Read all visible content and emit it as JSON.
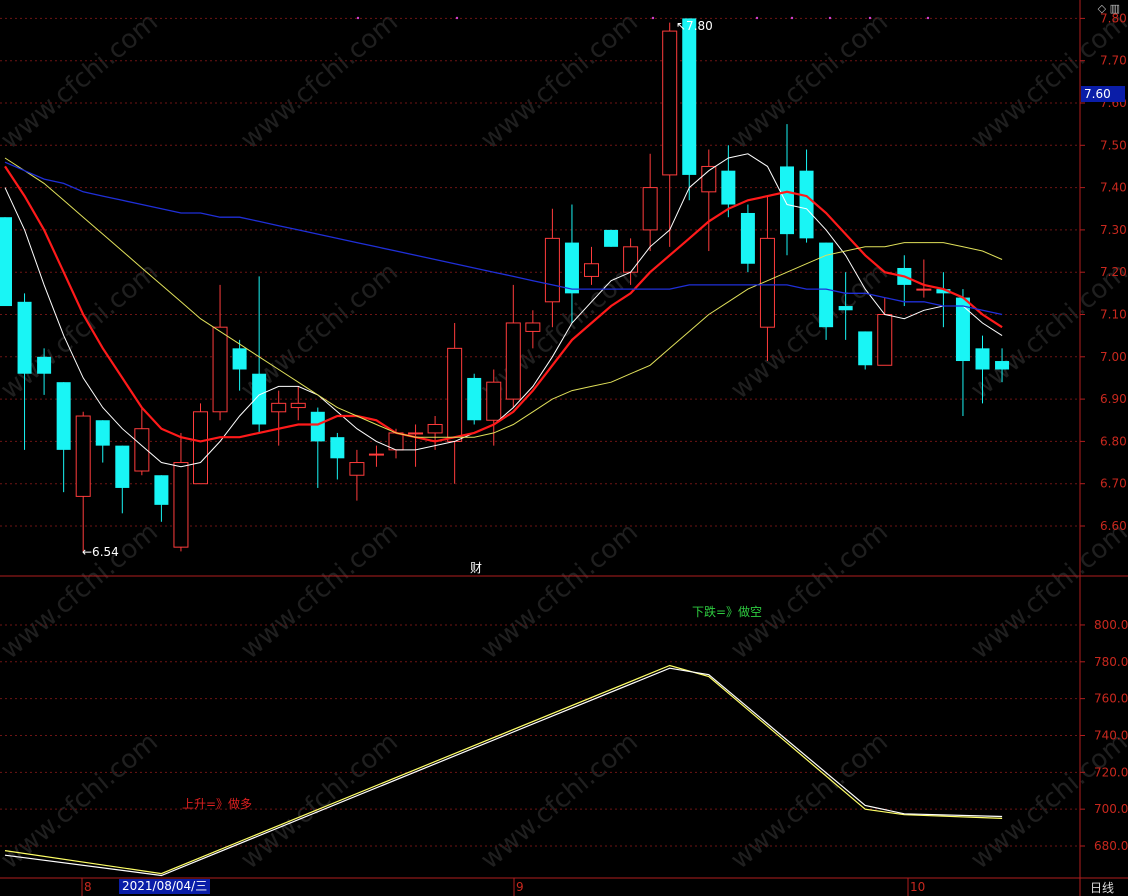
{
  "chart_data": {
    "type": "candlestick",
    "price_axis": {
      "ticks": [
        "7.80",
        "7.70",
        "7.60",
        "7.50",
        "7.40",
        "7.30",
        "7.20",
        "7.10",
        "7.00",
        "6.90",
        "6.80",
        "6.70",
        "6.60"
      ],
      "range": [
        6.48,
        7.82
      ]
    },
    "current_price": "7.60",
    "high_label": "7.80",
    "low_label": "6.54",
    "event_marker": "财",
    "candles": [
      {
        "o": 7.33,
        "c": 7.12,
        "h": 7.33,
        "l": 7.12
      },
      {
        "o": 7.13,
        "c": 6.96,
        "h": 7.15,
        "l": 6.78
      },
      {
        "o": 7.0,
        "c": 6.96,
        "h": 7.02,
        "l": 6.91
      },
      {
        "o": 6.94,
        "c": 6.78,
        "h": 6.94,
        "l": 6.68
      },
      {
        "o": 6.67,
        "c": 6.86,
        "h": 6.87,
        "l": 6.54
      },
      {
        "o": 6.85,
        "c": 6.79,
        "h": 6.85,
        "l": 6.75
      },
      {
        "o": 6.79,
        "c": 6.69,
        "h": 6.79,
        "l": 6.63
      },
      {
        "o": 6.73,
        "c": 6.83,
        "h": 6.88,
        "l": 6.72
      },
      {
        "o": 6.72,
        "c": 6.65,
        "h": 6.72,
        "l": 6.61
      },
      {
        "o": 6.55,
        "c": 6.75,
        "h": 6.82,
        "l": 6.54
      },
      {
        "o": 6.7,
        "c": 6.87,
        "h": 6.89,
        "l": 6.7
      },
      {
        "o": 6.87,
        "c": 7.07,
        "h": 7.17,
        "l": 6.85
      },
      {
        "o": 7.02,
        "c": 6.97,
        "h": 7.04,
        "l": 6.92
      },
      {
        "o": 6.96,
        "c": 6.84,
        "h": 7.19,
        "l": 6.82
      },
      {
        "o": 6.87,
        "c": 6.89,
        "h": 6.92,
        "l": 6.79
      },
      {
        "o": 6.88,
        "c": 6.89,
        "h": 6.93,
        "l": 6.85
      },
      {
        "o": 6.87,
        "c": 6.8,
        "h": 6.88,
        "l": 6.69
      },
      {
        "o": 6.81,
        "c": 6.76,
        "h": 6.82,
        "l": 6.71
      },
      {
        "o": 6.72,
        "c": 6.75,
        "h": 6.78,
        "l": 6.66
      },
      {
        "o": 6.77,
        "c": 6.77,
        "h": 6.79,
        "l": 6.74
      },
      {
        "o": 6.78,
        "c": 6.82,
        "h": 6.83,
        "l": 6.76
      },
      {
        "o": 6.82,
        "c": 6.82,
        "h": 6.84,
        "l": 6.74
      },
      {
        "o": 6.82,
        "c": 6.84,
        "h": 6.86,
        "l": 6.78
      },
      {
        "o": 6.8,
        "c": 7.02,
        "h": 7.08,
        "l": 6.7
      },
      {
        "o": 6.95,
        "c": 6.85,
        "h": 6.96,
        "l": 6.84
      },
      {
        "o": 6.85,
        "c": 6.94,
        "h": 6.97,
        "l": 6.79
      },
      {
        "o": 6.9,
        "c": 7.08,
        "h": 7.17,
        "l": 6.88
      },
      {
        "o": 7.06,
        "c": 7.08,
        "h": 7.11,
        "l": 7.02
      },
      {
        "o": 7.13,
        "c": 7.28,
        "h": 7.35,
        "l": 7.07
      },
      {
        "o": 7.27,
        "c": 7.15,
        "h": 7.36,
        "l": 7.08
      },
      {
        "o": 7.19,
        "c": 7.22,
        "h": 7.26,
        "l": 7.17
      },
      {
        "o": 7.3,
        "c": 7.26,
        "h": 7.3,
        "l": 7.26
      },
      {
        "o": 7.2,
        "c": 7.26,
        "h": 7.28,
        "l": 7.17
      },
      {
        "o": 7.3,
        "c": 7.4,
        "h": 7.48,
        "l": 7.25
      },
      {
        "o": 7.43,
        "c": 7.77,
        "h": 7.79,
        "l": 7.26
      },
      {
        "o": 7.8,
        "c": 7.43,
        "h": 7.8,
        "l": 7.37
      },
      {
        "o": 7.39,
        "c": 7.45,
        "h": 7.49,
        "l": 7.25
      },
      {
        "o": 7.44,
        "c": 7.36,
        "h": 7.5,
        "l": 7.33
      },
      {
        "o": 7.34,
        "c": 7.22,
        "h": 7.36,
        "l": 7.2
      },
      {
        "o": 7.07,
        "c": 7.28,
        "h": 7.38,
        "l": 6.99
      },
      {
        "o": 7.45,
        "c": 7.29,
        "h": 7.55,
        "l": 7.24
      },
      {
        "o": 7.44,
        "c": 7.28,
        "h": 7.49,
        "l": 7.27
      },
      {
        "o": 7.27,
        "c": 7.07,
        "h": 7.27,
        "l": 7.04
      },
      {
        "o": 7.12,
        "c": 7.11,
        "h": 7.2,
        "l": 7.04
      },
      {
        "o": 7.06,
        "c": 6.98,
        "h": 7.06,
        "l": 6.97
      },
      {
        "o": 6.98,
        "c": 7.1,
        "h": 7.14,
        "l": 6.98
      },
      {
        "o": 7.21,
        "c": 7.17,
        "h": 7.24,
        "l": 7.12
      },
      {
        "o": 7.16,
        "c": 7.16,
        "h": 7.23,
        "l": 7.14
      },
      {
        "o": 7.16,
        "c": 7.15,
        "h": 7.2,
        "l": 7.07
      },
      {
        "o": 7.14,
        "c": 6.99,
        "h": 7.16,
        "l": 6.86
      },
      {
        "o": 7.02,
        "c": 6.97,
        "h": 7.05,
        "l": 6.89
      },
      {
        "o": 6.99,
        "c": 6.97,
        "h": 7.02,
        "l": 6.94
      }
    ],
    "ma": [
      {
        "color": "#ffffff",
        "width": 1,
        "values": [
          7.4,
          7.3,
          7.17,
          7.05,
          6.95,
          6.88,
          6.83,
          6.79,
          6.75,
          6.74,
          6.75,
          6.8,
          6.86,
          6.91,
          6.93,
          6.93,
          6.91,
          6.87,
          6.83,
          6.8,
          6.78,
          6.78,
          6.79,
          6.8,
          6.82,
          6.84,
          6.88,
          6.93,
          7.0,
          7.08,
          7.13,
          7.18,
          7.2,
          7.26,
          7.3,
          7.4,
          7.44,
          7.47,
          7.48,
          7.45,
          7.36,
          7.35,
          7.3,
          7.24,
          7.16,
          7.1,
          7.09,
          7.11,
          7.12,
          7.12,
          7.08,
          7.05
        ]
      },
      {
        "color": "#ff1a1a",
        "width": 2.2,
        "values": [
          7.45,
          7.38,
          7.3,
          7.2,
          7.1,
          7.02,
          6.95,
          6.88,
          6.83,
          6.81,
          6.8,
          6.81,
          6.81,
          6.82,
          6.83,
          6.84,
          6.84,
          6.86,
          6.86,
          6.85,
          6.82,
          6.81,
          6.8,
          6.81,
          6.82,
          6.84,
          6.87,
          6.92,
          6.98,
          7.04,
          7.08,
          7.12,
          7.15,
          7.2,
          7.24,
          7.28,
          7.32,
          7.35,
          7.37,
          7.38,
          7.39,
          7.38,
          7.34,
          7.29,
          7.24,
          7.2,
          7.19,
          7.17,
          7.16,
          7.14,
          7.1,
          7.07
        ]
      },
      {
        "color": "#e0e05a",
        "width": 1,
        "values": [
          7.47,
          7.44,
          7.41,
          7.37,
          7.33,
          7.29,
          7.25,
          7.21,
          7.17,
          7.13,
          7.09,
          7.06,
          7.03,
          7.0,
          6.97,
          6.94,
          6.91,
          6.88,
          6.86,
          6.84,
          6.82,
          6.81,
          6.81,
          6.81,
          6.81,
          6.82,
          6.84,
          6.87,
          6.9,
          6.92,
          6.93,
          6.94,
          6.96,
          6.98,
          7.02,
          7.06,
          7.1,
          7.13,
          7.16,
          7.18,
          7.2,
          7.22,
          7.24,
          7.25,
          7.26,
          7.26,
          7.27,
          7.27,
          7.27,
          7.26,
          7.25,
          7.23
        ]
      },
      {
        "color": "#1f2fd8",
        "width": 1.3,
        "values": [
          7.46,
          7.44,
          7.42,
          7.41,
          7.39,
          7.38,
          7.37,
          7.36,
          7.35,
          7.34,
          7.34,
          7.33,
          7.33,
          7.32,
          7.31,
          7.3,
          7.29,
          7.28,
          7.27,
          7.26,
          7.25,
          7.24,
          7.23,
          7.22,
          7.21,
          7.2,
          7.19,
          7.18,
          7.17,
          7.16,
          7.16,
          7.16,
          7.16,
          7.16,
          7.16,
          7.17,
          7.17,
          7.17,
          7.17,
          7.17,
          7.17,
          7.16,
          7.16,
          7.15,
          7.15,
          7.14,
          7.13,
          7.13,
          7.12,
          7.12,
          7.11,
          7.1
        ]
      }
    ],
    "indicator_axis": {
      "ticks": [
        "800.0",
        "780.0",
        "760.0",
        "740.0",
        "720.0",
        "700.0",
        "680.0"
      ],
      "range": [
        668,
        812
      ]
    },
    "indicator_lines": [
      {
        "color": "#ffff66",
        "points": [
          [
            0,
            677.5
          ],
          [
            8,
            665
          ],
          [
            34,
            778
          ],
          [
            36,
            772
          ],
          [
            44,
            700
          ],
          [
            46,
            697
          ],
          [
            51,
            695
          ]
        ]
      },
      {
        "color": "#ffffff",
        "points": [
          [
            0,
            675
          ],
          [
            8,
            664
          ],
          [
            34,
            776.5
          ],
          [
            36,
            773
          ],
          [
            44,
            702
          ],
          [
            46,
            697.5
          ],
          [
            51,
            696
          ]
        ]
      }
    ],
    "annotations": {
      "down": "下跌=》做空",
      "up": "上升=》做多"
    },
    "x_labels": [
      "8",
      "9",
      "10"
    ],
    "date_label": "2021/08/04/三",
    "period_label": "日线",
    "watermark": "www.cfchi.com"
  }
}
